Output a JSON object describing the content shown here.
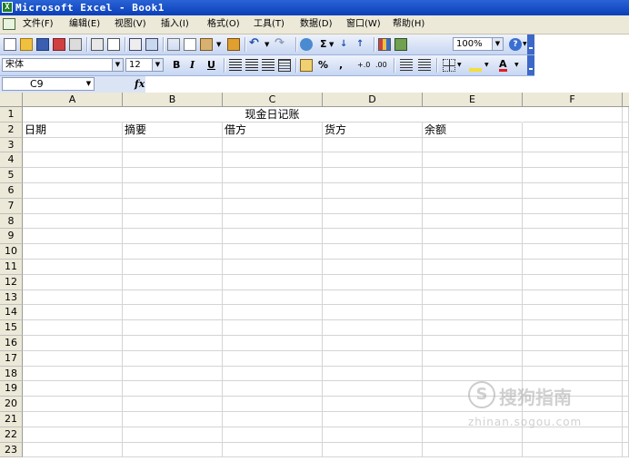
{
  "window": {
    "title": "Microsoft Excel - Book1",
    "app_icon": "excel-icon"
  },
  "menu": {
    "items": [
      "文件(F)",
      "编辑(E)",
      "视图(V)",
      "插入(I)",
      "格式(O)",
      "工具(T)",
      "数据(D)",
      "窗口(W)",
      "帮助(H)"
    ]
  },
  "toolbar": {
    "zoom": "100%",
    "font_name": "宋体",
    "font_size": "12",
    "bold": "B",
    "italic": "I",
    "underline": "U",
    "percent": "%",
    "comma": ",",
    "sum": "Σ",
    "increase_decimal": "+.0",
    "decrease_decimal": ".00",
    "font_color": "A"
  },
  "formula_bar": {
    "name_box": "C9",
    "fx": "fx",
    "content": ""
  },
  "sheet": {
    "columns": [
      "A",
      "B",
      "C",
      "D",
      "E",
      "F"
    ],
    "rows": [
      "1",
      "2",
      "3",
      "4",
      "5",
      "6",
      "7",
      "8",
      "9",
      "10",
      "11",
      "12",
      "13",
      "14",
      "15",
      "16",
      "17",
      "18",
      "19",
      "20",
      "21",
      "22",
      "23"
    ],
    "title": "现金日记账",
    "headers": [
      "日期",
      "摘要",
      "借方",
      "货方",
      "余额"
    ]
  },
  "watermark": {
    "brand": "搜狗指南",
    "url": "zhinan.sogou.com"
  },
  "colors": {
    "title_bar": "#0a3fb8",
    "toolbar": "#c7d6f2",
    "header_bg": "#ece9d8",
    "grid_line": "#d4d4d4"
  }
}
